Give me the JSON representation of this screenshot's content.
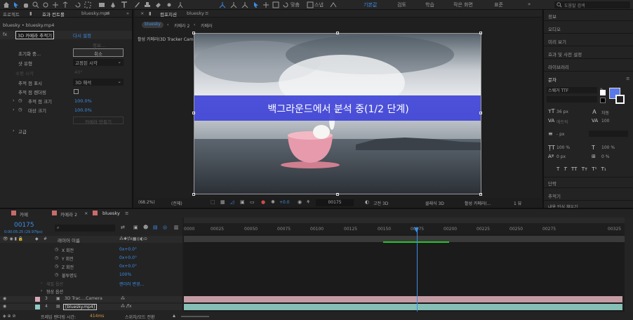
{
  "toolbar": {
    "workspaces": [
      "기본값",
      "검토",
      "학습",
      "작은 화면",
      "표준"
    ],
    "active_workspace": "기본값",
    "search_placeholder": "도움말 검색"
  },
  "effect_panel": {
    "tabs": [
      "프로젝트",
      "효과 컨트롤"
    ],
    "active_tab_file": "bluesky.mp4",
    "breadcrumb": "bluesky • bluesky.mp4",
    "effect_name": "3D 카메라 추적기",
    "reset_label": "다시 설정",
    "about_label": "정보...",
    "analyzing_label": "초기화 중...",
    "cancel_button": "취소",
    "shot_type_label": "샷 유형",
    "shot_type_value": "고정된 시각",
    "horizontal_fov_label": "수평 시각",
    "horizontal_fov_value": "40°",
    "show_track_points_label": "추적 점 표시",
    "show_track_points_value": "3D 해석",
    "render_track_points_label": "추적 점 렌더링",
    "track_point_size_label": "추적 점 크기",
    "track_point_size_value": "100.0%",
    "target_size_label": "대상 크기",
    "target_size_value": "100.0%",
    "create_camera_label": "카메라 만들기",
    "advanced_label": "고급"
  },
  "composition": {
    "tabs": [
      "컴포지션",
      "bluesky"
    ],
    "sub_tabs": [
      "bluesky",
      "카메라 2",
      "카메라"
    ],
    "camera_label": "활성 카메라(3D Tracker Camera)",
    "banner_text": "백그라운드에서 분석 중(1/2 단계)",
    "zoom": "(68.2%)",
    "resolution": "(전체)",
    "exposure": "+0.0",
    "timecode": "00175",
    "renderer": "고전 3D",
    "view_mode": "클래식 3D",
    "active_camera": "활성 카메라(...",
    "views": "1 뷰"
  },
  "right_panel": {
    "items": [
      "정보",
      "오디오",
      "미리 보기",
      "효과 및 사전 설정",
      "라이브러리"
    ],
    "character_title": "문자",
    "font_family": "스웨거 TTF",
    "font_size": "36 px",
    "leading": "자동",
    "tracking_kerning": "메트릭",
    "tracking_value": "100",
    "stroke_width": "- px",
    "vertical_scale": "100 %",
    "horizontal_scale": "100 %",
    "baseline_shift": "0 px",
    "tsume": "0 %",
    "style_buttons": [
      "T",
      "T",
      "TT",
      "Tт",
      "T¹",
      "T₁"
    ],
    "paragraph_title": "단락",
    "tracker_title": "추적기",
    "content_aware_fill": "내용 인식 채우기",
    "fill_color": "#5a79e6"
  },
  "timeline": {
    "tabs": [
      "카메",
      "카메라 2",
      "bluesky"
    ],
    "timecode": "00175",
    "timecode_sub": "0:00:05:25 (29.97fps)",
    "layer_header": "레이어 이름",
    "ticks": [
      "0000",
      "00025",
      "00050",
      "00075",
      "00100",
      "00125",
      "00150",
      "00175",
      "00200",
      "00225",
      "00250",
      "00275",
      "00325"
    ],
    "props": [
      {
        "name": "X 회전",
        "value": "0x+0.0°"
      },
      {
        "name": "Y 회전",
        "value": "0x+0.0°"
      },
      {
        "name": "Z 회전",
        "value": "0x+0.0°"
      },
      {
        "name": "불투명도",
        "value": "100%"
      }
    ],
    "material_options": "재질 옵션",
    "geometry_options": "형상 옵션",
    "renderer_change": "렌더러 변경...",
    "layers": [
      {
        "num": "3",
        "name": "3D Trac....Camera"
      },
      {
        "num": "4",
        "name": "[bluesky.mp4]"
      }
    ],
    "footer_render_time_label": "프레임 렌더링 시간:",
    "footer_render_time": "414ms",
    "footer_mode": "스위치/모드 전환"
  }
}
